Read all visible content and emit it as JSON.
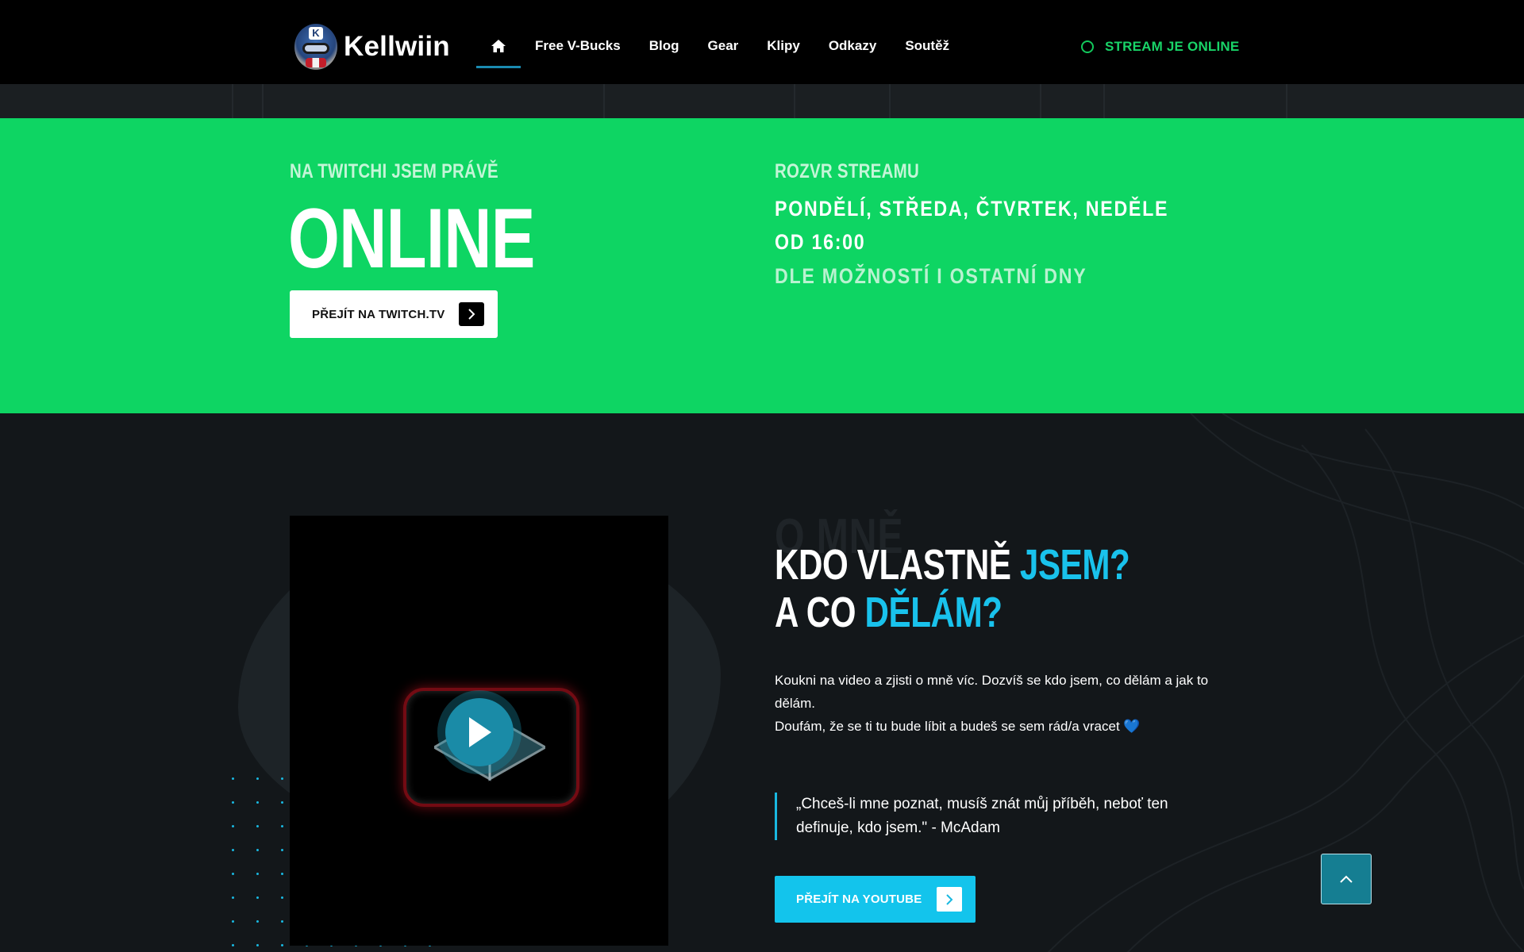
{
  "header": {
    "logo_text": "Kellwiin",
    "nav": {
      "home_icon": "home-icon",
      "items": [
        {
          "label": "Free V-Bucks"
        },
        {
          "label": "Blog"
        },
        {
          "label": "Gear"
        },
        {
          "label": "Klipy"
        },
        {
          "label": "Odkazy"
        },
        {
          "label": "Soutěž"
        }
      ]
    },
    "stream_status": "STREAM JE ONLINE"
  },
  "banner": {
    "kicker": "NA TWITCHI JSEM PRÁVĚ",
    "status": "ONLINE",
    "twitch_button": "PŘEJÍT NA TWITCH.TV",
    "schedule_kicker": "ROZVR STREAMU",
    "schedule_days": "PONDĚLÍ, STŘEDA, ČTVRTEK, NEDĚLE",
    "schedule_time": "OD 16:00",
    "schedule_note": "DLE MOŽNOSTÍ I OSTATNÍ DNY"
  },
  "about": {
    "bg_word": "O MNĚ",
    "heading_line1_white": "KDO VLASTNĚ ",
    "heading_line1_blue": "JSEM?",
    "heading_line2_white": "A CO ",
    "heading_line2_blue": "DĚLÁM?",
    "paragraph_line1": "Koukni na video a zjisti o mně víc. Dozvíš se kdo jsem, co dělám a jak to dělám.",
    "paragraph_line2": "Doufám, že se ti tu bude líbit a budeš se sem rád/a vracet 💙",
    "quote": "„Chceš-li mne poznat, musíš znát můj příběh, neboť ten definuje, kdo jsem.\" - McAdam",
    "youtube_button": "PŘEJÍT NA YOUTUBE"
  },
  "colors": {
    "green": "#0ed563",
    "accent_blue": "#19c2ec",
    "header_bg": "#000000",
    "section_bg": "#13171a"
  }
}
